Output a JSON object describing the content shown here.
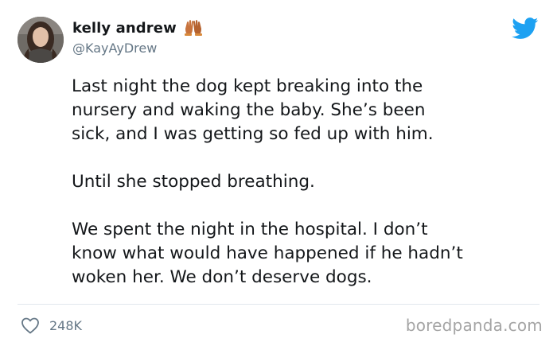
{
  "author": {
    "display_name": "kelly andrew",
    "handle": "@KayAyDrew",
    "avatar_icon": "profile-photo",
    "name_badge_icon": "raised-hands-icon"
  },
  "platform_icon": "twitter-bird-icon",
  "tweet": {
    "paragraphs": [
      "Last night the dog kept breaking into the\nnursery and waking the baby. She’s been\nsick, and I was getting so fed up with him.",
      "Until she stopped breathing.",
      "We spent the night in the hospital. I don’t\nknow what would have happened if he hadn’t\nwoken her. We don’t deserve dogs."
    ]
  },
  "footer": {
    "like_icon": "heart-icon",
    "like_count": "248K",
    "watermark": "boredpanda.com"
  },
  "colors": {
    "text": "#14171a",
    "secondary_text": "#657786",
    "twitter_blue": "#1da1f2",
    "divider": "#e1e8ed",
    "watermark": "#a5a5a5"
  }
}
